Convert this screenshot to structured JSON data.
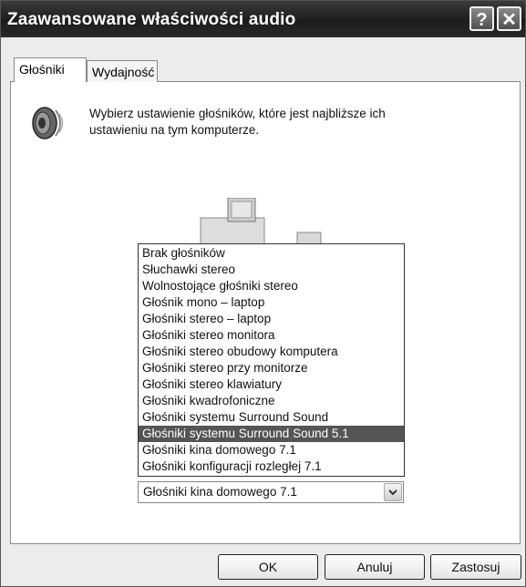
{
  "window": {
    "title": "Zaawansowane właściwości audio",
    "help_label": "?",
    "close_label": "✕"
  },
  "tabs": [
    {
      "label": "Głośniki",
      "active": true
    },
    {
      "label": "Wydajność",
      "active": false
    }
  ],
  "description": "Wybierz ustawienie głośników, które jest najbliższe ich ustawieniu na tym komputerze.",
  "speaker_setup": {
    "options": [
      "Brak głośników",
      "Słuchawki stereo",
      "Wolnostojące głośniki stereo",
      "Głośnik mono – laptop",
      "Głośniki stereo – laptop",
      "Głośniki stereo monitora",
      "Głośniki stereo obudowy komputera",
      "Głośniki stereo przy monitorze",
      "Głośniki stereo klawiatury",
      "Głośniki kwadrofoniczne",
      "Głośniki systemu Surround Sound",
      "Głośniki systemu Surround Sound 5.1",
      "Głośniki kina domowego 7.1",
      "Głośniki konfiguracji rozległej 7.1"
    ],
    "highlighted_option": "Głośniki systemu Surround Sound 5.1",
    "selected_value": "Głośniki kina domowego 7.1"
  },
  "buttons": {
    "ok": "OK",
    "cancel": "Anuluj",
    "apply": "Zastosuj"
  },
  "colors": {
    "titlebar": "#2a2a2a",
    "highlight": "#555555"
  }
}
